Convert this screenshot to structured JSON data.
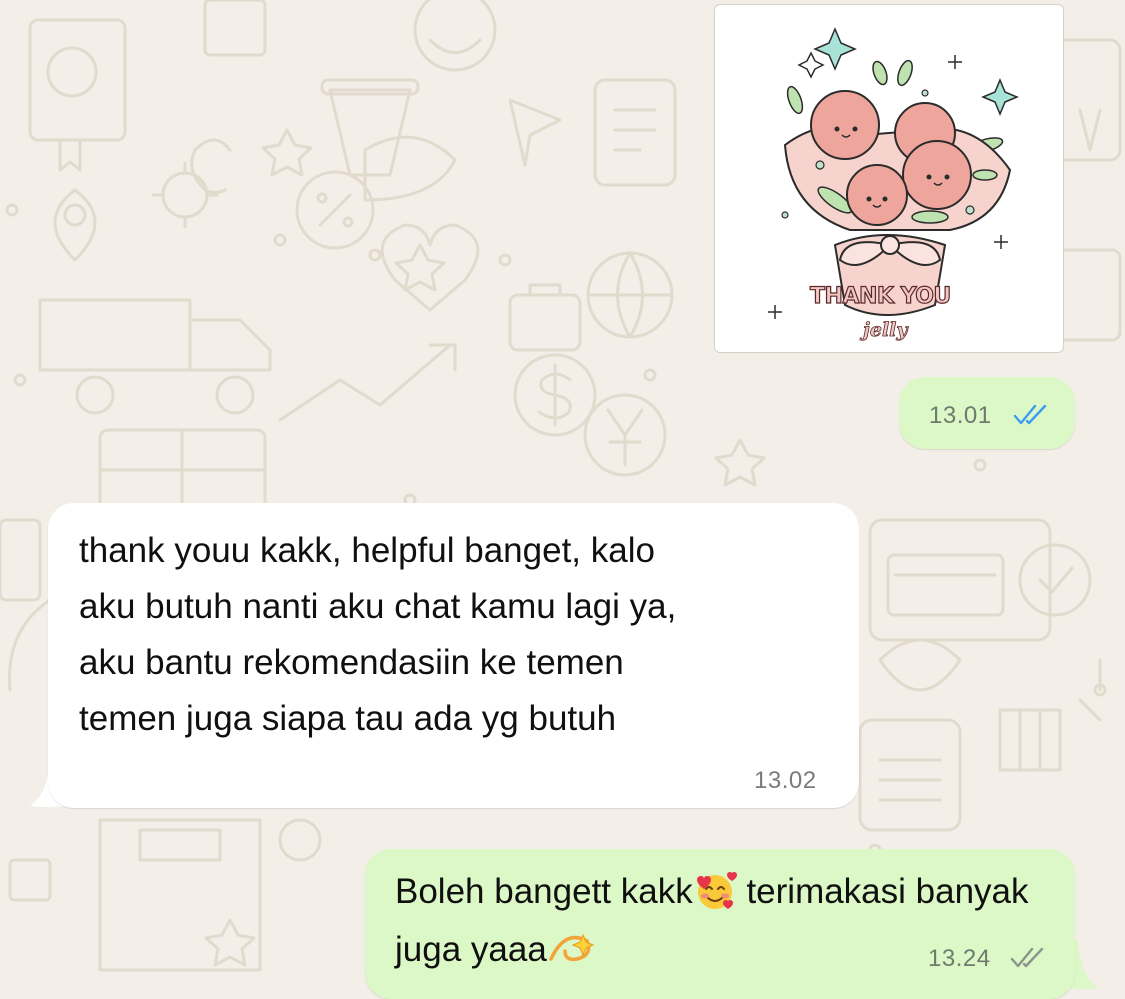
{
  "theme": {
    "wallpaper_color": "#f3eee7",
    "wallpaper_doodle_color": "#e2dacd",
    "outgoing_bubble_color": "#dcf8c6",
    "incoming_bubble_color": "#ffffff",
    "read_tick_color": "#3e9bf0",
    "delivered_tick_color": "#8a948b"
  },
  "messages": [
    {
      "direction": "outgoing",
      "kind": "sticker",
      "sticker": {
        "caption_line1": "THANK YOU",
        "caption_line2": "jelly",
        "icon": "flower-bouquet-sticker"
      },
      "time": "13.01",
      "status": "read"
    },
    {
      "direction": "incoming",
      "kind": "text",
      "text": "thank youu kakk, helpful banget, kalo\naku butuh nanti aku chat kamu lagi ya,\naku bantu rekomendasiin ke temen\ntemen juga siapa tau ada yg butuh",
      "time": "13.02"
    },
    {
      "direction": "outgoing",
      "kind": "text",
      "text_part1": "Boleh bangett kakk",
      "emoji1": "smiling-face-with-hearts-emoji",
      "text_part2": " terimakasi banyak juga yaaa",
      "emoji2": "dizzy-emoji",
      "time": "13.24",
      "status": "delivered"
    }
  ]
}
